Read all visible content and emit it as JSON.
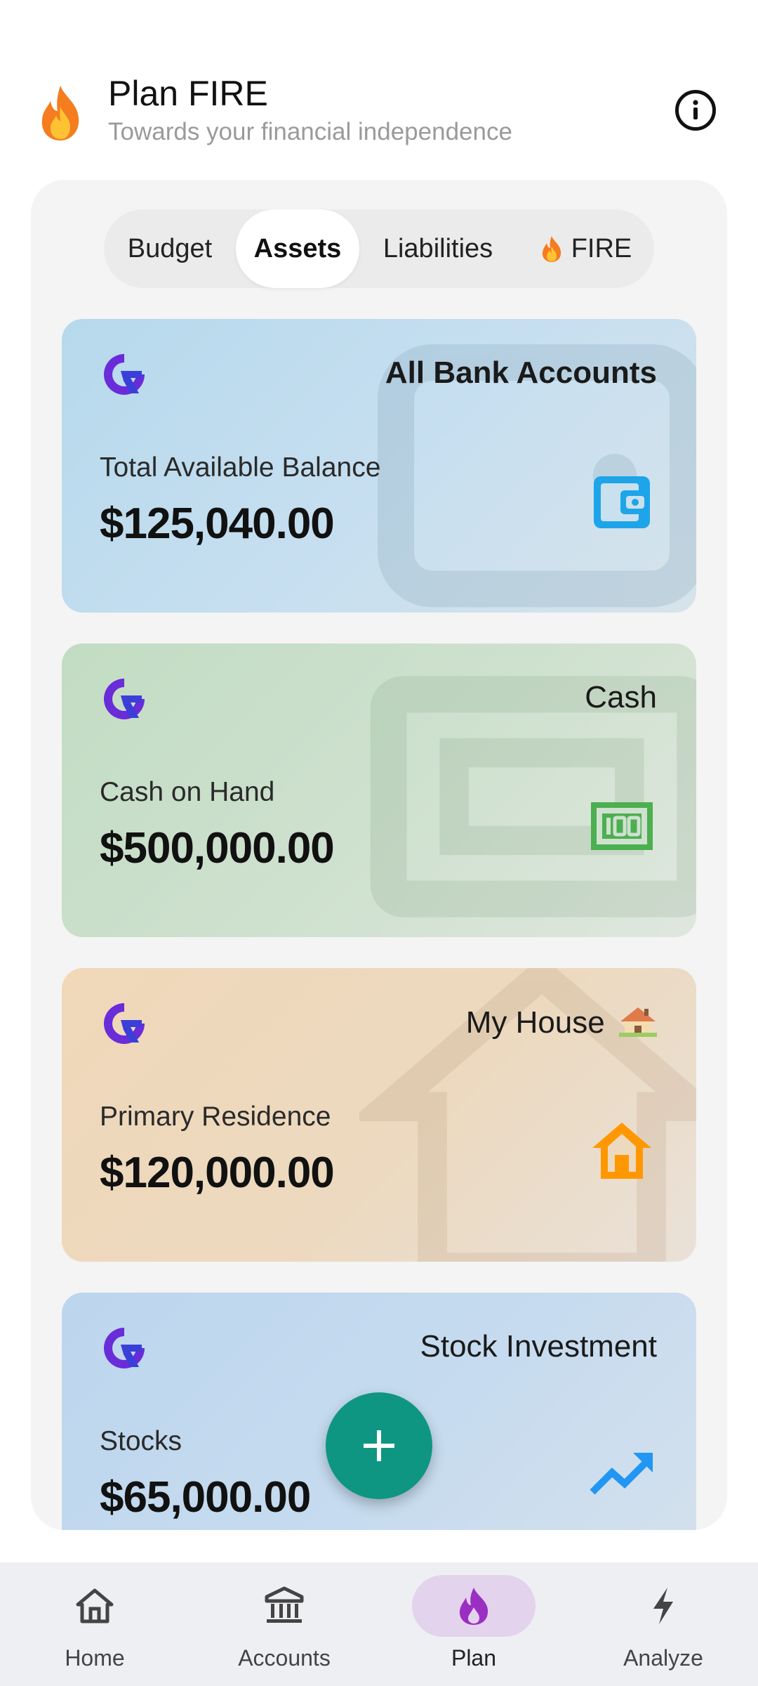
{
  "header": {
    "title": "Plan FIRE",
    "subtitle": "Towards your financial independence",
    "flame_icon": "fire-emoji",
    "info_icon": "info-icon"
  },
  "tabs": [
    {
      "label": "Budget",
      "active": false
    },
    {
      "label": "Assets",
      "active": true
    },
    {
      "label": "Liabilities",
      "active": false
    },
    {
      "label": "FIRE",
      "emoji": "fire-emoji",
      "active": false
    }
  ],
  "cards": [
    {
      "title": "All Bank Accounts",
      "label": "Total Available Balance",
      "amount": "$125,040.00",
      "icon": "wallet-icon",
      "accent": "#1ea5e9"
    },
    {
      "title": "Cash",
      "label": "Cash on Hand",
      "amount": "$500,000.00",
      "icon": "money-100-icon",
      "accent": "#4caf50"
    },
    {
      "title": "My House",
      "title_emoji": "house-emoji",
      "label": "Primary Residence",
      "amount": "$120,000.00",
      "icon": "home-icon",
      "accent": "#ff9800"
    },
    {
      "title": "Stock Investment",
      "label": "Stocks",
      "amount": "$65,000.00",
      "icon": "trending-up-icon",
      "accent": "#2196f3"
    }
  ],
  "fab": {
    "icon": "plus-icon",
    "color": "#0e9683"
  },
  "bottom_nav": [
    {
      "label": "Home",
      "icon": "home-outline-icon",
      "active": false
    },
    {
      "label": "Accounts",
      "icon": "bank-icon",
      "active": false
    },
    {
      "label": "Plan",
      "icon": "flame-icon",
      "active": true
    },
    {
      "label": "Analyze",
      "icon": "bolt-icon",
      "active": false
    }
  ],
  "colors": {
    "logo_purple": "#6a2bd9",
    "logo_blue": "#3a3fd8",
    "nav_active_bg": "#e4d3ec",
    "plan_flame": "#9b2fc4"
  }
}
